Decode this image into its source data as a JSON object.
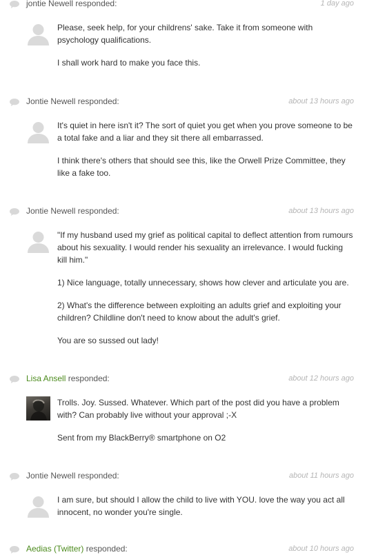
{
  "comments": [
    {
      "author": "jontie Newell",
      "responded": "responded:",
      "time": "1 day ago",
      "paragraphs": [
        "Please, seek help, for your childrens' sake. Take it from someone with psychology qualifications.",
        "I shall work hard to make you face this."
      ]
    },
    {
      "author": "Jontie Newell",
      "responded": "responded:",
      "time": "about 13 hours ago",
      "paragraphs": [
        "It's quiet in here isn't it? The sort of quiet you get when you prove someone to be a total fake and a liar and they sit there all embarrassed.",
        "I think there's others that should see this, like the Orwell Prize Committee, they like a fake too."
      ]
    },
    {
      "author": "Jontie Newell",
      "responded": "responded:",
      "time": "about 13 hours ago",
      "paragraphs": [
        "\"If my husband used my grief as political capital to deflect attention from rumours about his sexuality. I would render his sexuality an irrelevance. I would fucking kill him.\"",
        "1) Nice language, totally unnecessary, shows how clever and articulate you are.",
        "2) What's the difference between exploiting an adults grief and exploiting your children? Childline don't need to know about the adult's grief.",
        "You are so sussed out lady!"
      ]
    },
    {
      "author": "Lisa Ansell",
      "responded": "responded:",
      "time": "about 12 hours ago",
      "paragraphs": [
        "Trolls. Joy. Sussed. Whatever. Which part of the post did you have a problem with? Can probably live without your approval ;-X",
        "Sent from my BlackBerry® smartphone on O2"
      ]
    },
    {
      "author": "Jontie Newell",
      "responded": "responded:",
      "time": "about 11 hours ago",
      "paragraphs": [
        "I am sure, but should I allow the child to live with YOU. love the way you act all innocent, no wonder you're single."
      ]
    },
    {
      "author": "Aedias (Twitter)",
      "responded": "responded:",
      "time": "about 10 hours ago",
      "paragraphs": []
    }
  ]
}
